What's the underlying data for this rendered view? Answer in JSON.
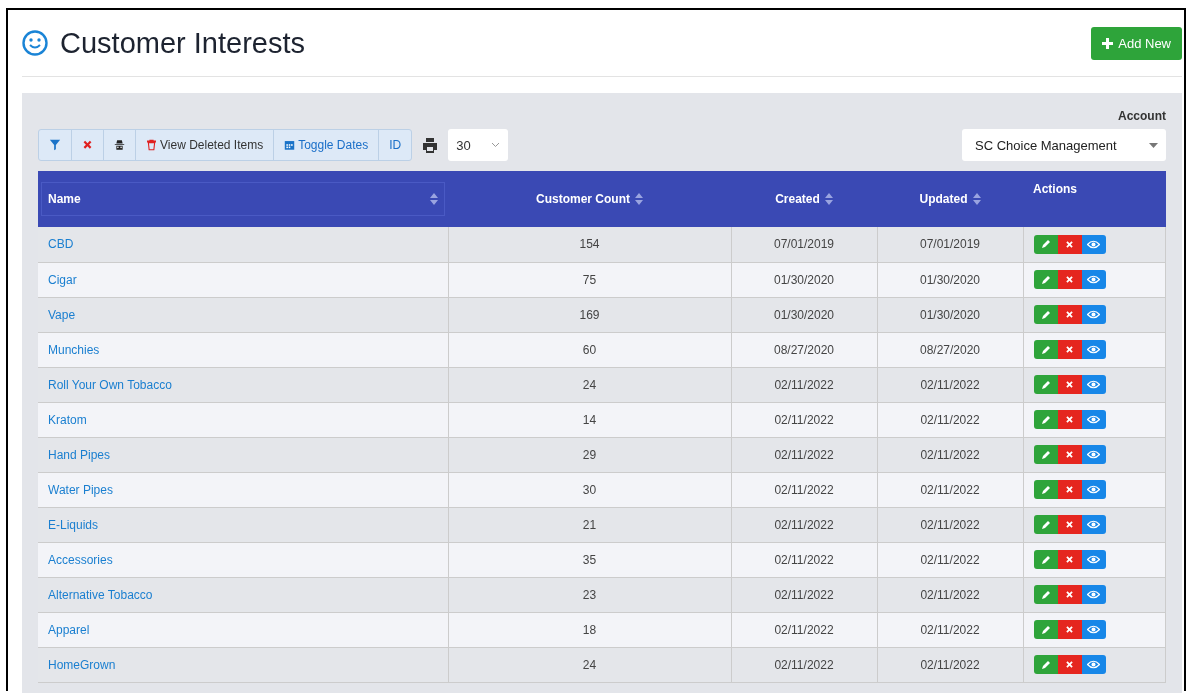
{
  "page": {
    "title": "Customer Interests",
    "add_button": "Add New"
  },
  "toolbar": {
    "buttons": [
      {
        "kind": "filter"
      },
      {
        "kind": "clear"
      },
      {
        "kind": "spy"
      },
      {
        "kind": "deleted",
        "label": "View Deleted Items"
      },
      {
        "kind": "dates",
        "label": "Toggle Dates"
      },
      {
        "kind": "id",
        "label": "ID"
      }
    ],
    "page_size": "30"
  },
  "account": {
    "label": "Account",
    "value": "SC Choice Management"
  },
  "table": {
    "columns": [
      {
        "label": "Name",
        "sortable": true
      },
      {
        "label": "Customer Count",
        "sortable": true
      },
      {
        "label": "Created",
        "sortable": true
      },
      {
        "label": "Updated",
        "sortable": true
      },
      {
        "label": "Actions",
        "sortable": false
      }
    ],
    "rows": [
      {
        "name": "CBD",
        "count": "154",
        "created": "07/01/2019",
        "updated": "07/01/2019"
      },
      {
        "name": "Cigar",
        "count": "75",
        "created": "01/30/2020",
        "updated": "01/30/2020"
      },
      {
        "name": "Vape",
        "count": "169",
        "created": "01/30/2020",
        "updated": "01/30/2020"
      },
      {
        "name": "Munchies",
        "count": "60",
        "created": "08/27/2020",
        "updated": "08/27/2020"
      },
      {
        "name": "Roll Your Own Tobacco",
        "count": "24",
        "created": "02/11/2022",
        "updated": "02/11/2022"
      },
      {
        "name": "Kratom",
        "count": "14",
        "created": "02/11/2022",
        "updated": "02/11/2022"
      },
      {
        "name": "Hand Pipes",
        "count": "29",
        "created": "02/11/2022",
        "updated": "02/11/2022"
      },
      {
        "name": "Water Pipes",
        "count": "30",
        "created": "02/11/2022",
        "updated": "02/11/2022"
      },
      {
        "name": "E-Liquids",
        "count": "21",
        "created": "02/11/2022",
        "updated": "02/11/2022"
      },
      {
        "name": "Accessories",
        "count": "35",
        "created": "02/11/2022",
        "updated": "02/11/2022"
      },
      {
        "name": "Alternative Tobacco",
        "count": "23",
        "created": "02/11/2022",
        "updated": "02/11/2022"
      },
      {
        "name": "Apparel",
        "count": "18",
        "created": "02/11/2022",
        "updated": "02/11/2022"
      },
      {
        "name": "HomeGrown",
        "count": "24",
        "created": "02/11/2022",
        "updated": "02/11/2022"
      }
    ]
  }
}
